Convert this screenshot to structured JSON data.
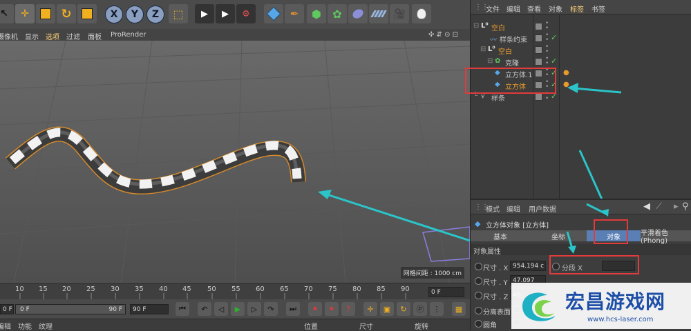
{
  "viewport_menu": {
    "items": [
      "摄像机",
      "显示",
      "选项",
      "过滤",
      "面板",
      "ProRender"
    ],
    "active_index": 2
  },
  "viewport": {
    "grid_info": "网格间距 : 1000 cm"
  },
  "timeline": {
    "ticks": [
      "10",
      "15",
      "20",
      "25",
      "30",
      "35",
      "40",
      "45",
      "50",
      "55",
      "60",
      "65",
      "70",
      "75",
      "80",
      "85",
      "90"
    ],
    "current_frame": "0 F"
  },
  "transport": {
    "start_field": "0 F",
    "end_field_inner": "90 F",
    "end_field": "90 F"
  },
  "bottom_tabs": {
    "items": [
      "编辑",
      "功能",
      "纹理"
    ],
    "coord_headers": [
      "位置",
      "尺寸",
      "旋转"
    ]
  },
  "object_manager": {
    "menu": [
      "文件",
      "编辑",
      "查看",
      "对象",
      "标签",
      "书签"
    ],
    "active_menu_index": 4,
    "objects": [
      {
        "name": "空白",
        "level": 0,
        "icon": "null-object-icon",
        "orange": true
      },
      {
        "name": "样条约束",
        "level": 1,
        "icon": "spline-constraint-icon",
        "orange": false
      },
      {
        "name": "空白",
        "level": 1,
        "icon": "null-object-icon",
        "orange": true
      },
      {
        "name": "克隆",
        "level": 1,
        "icon": "cloner-icon",
        "orange": false
      },
      {
        "name": "立方体.1",
        "level": 2,
        "icon": "cube-icon",
        "orange": false
      },
      {
        "name": "立方体",
        "level": 2,
        "icon": "cube-icon",
        "orange": true
      },
      {
        "name": "样条",
        "level": 0,
        "icon": "spline-icon",
        "orange": false
      }
    ]
  },
  "attribute_manager": {
    "menu": [
      "模式",
      "编辑",
      "用户数据"
    ],
    "object_title": "立方体对象 [立方体]",
    "tabs": [
      "基本",
      "坐标",
      "对象",
      "平滑着色(Phong)"
    ],
    "active_tab_index": 2,
    "section_title": "对象属性",
    "size_x_label": "尺寸 . X",
    "size_x_value": "954.194 c",
    "size_y_label": "尺寸 . Y",
    "size_y_value": "47.097",
    "size_z_label": "尺寸 . Z",
    "size_z_value": "46",
    "segments_label": "分段 X",
    "separate_surfaces": "分离表面",
    "fillet": "圆角"
  },
  "watermark": {
    "brand": "宏昌游戏网",
    "url": "www.hcs-laser.com"
  },
  "colors": {
    "accent_blue": "#5a7fb5",
    "highlight_orange": "#e89a2e",
    "annotation_red": "#e23b3b",
    "annotation_cyan": "#2bc4c9"
  }
}
